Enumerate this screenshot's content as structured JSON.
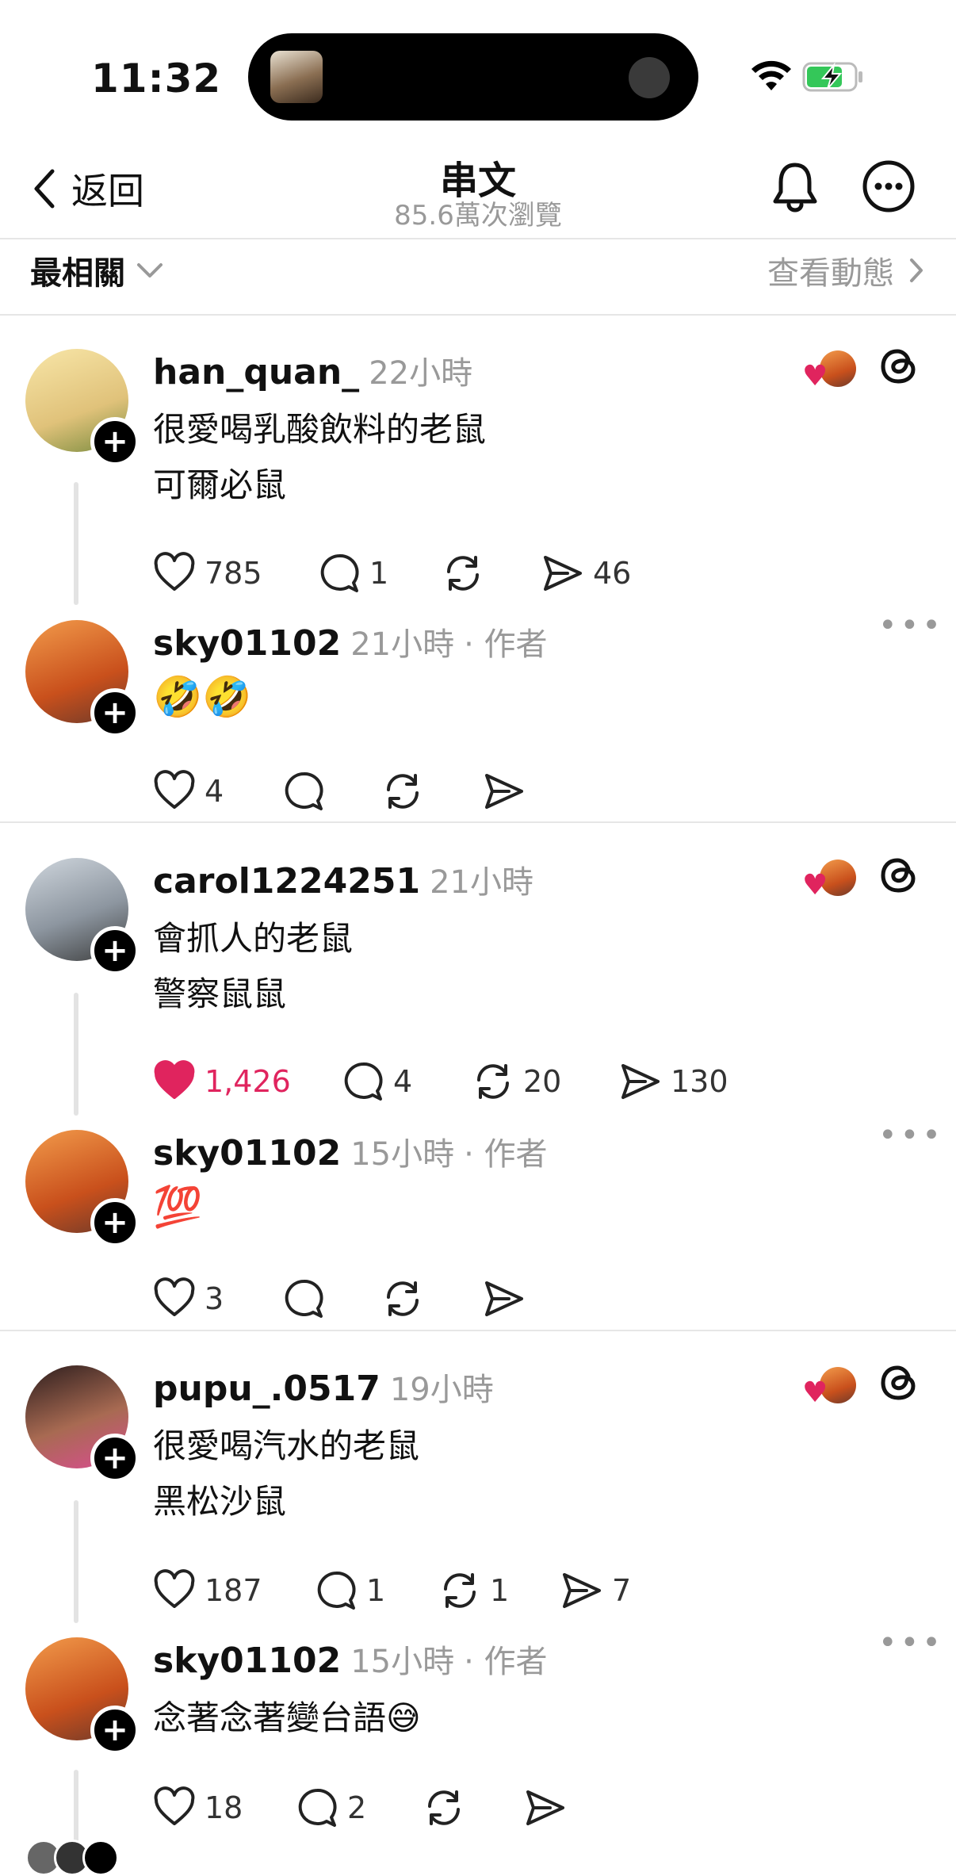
{
  "status": {
    "time": "11:32"
  },
  "header": {
    "back_label": "返回",
    "title": "串文",
    "views": "85.6萬次瀏覽"
  },
  "sort": {
    "label": "最相關",
    "activity_label": "查看動態"
  },
  "colors": {
    "like_red": "#e0245e",
    "plus_black": "#000000",
    "meta_gray": "#999999"
  },
  "posts": [
    {
      "user": "han_quan_",
      "time": "22小時",
      "lines": [
        "很愛喝乳酸飲料的老鼠",
        "可爾必鼠"
      ],
      "likes": "785",
      "replies": "1",
      "reposts": "",
      "shares": "46"
    },
    {
      "user": "sky01102",
      "time": "21小時",
      "author_tag": "· 作者",
      "lines": [
        "🤣🤣"
      ],
      "likes": "4",
      "replies": "",
      "reposts": "",
      "shares": ""
    },
    {
      "user": "carol1224251",
      "time": "21小時",
      "lines": [
        "會抓人的老鼠",
        "警察鼠鼠"
      ],
      "likes": "1,426",
      "replies": "4",
      "reposts": "20",
      "shares": "130"
    },
    {
      "user": "sky01102",
      "time": "15小時",
      "author_tag": "· 作者",
      "lines": [
        "💯"
      ],
      "likes": "3",
      "replies": "",
      "reposts": "",
      "shares": ""
    },
    {
      "user": "pupu_.0517",
      "time": "19小時",
      "lines": [
        "很愛喝汽水的老鼠",
        "黑松沙鼠"
      ],
      "likes": "187",
      "replies": "1",
      "reposts": "1",
      "shares": "7"
    },
    {
      "user": "sky01102",
      "time": "15小時",
      "author_tag": "· 作者",
      "lines": [
        "念著念著變台語😅"
      ],
      "likes": "18",
      "replies": "2",
      "reposts": "",
      "shares": ""
    }
  ]
}
